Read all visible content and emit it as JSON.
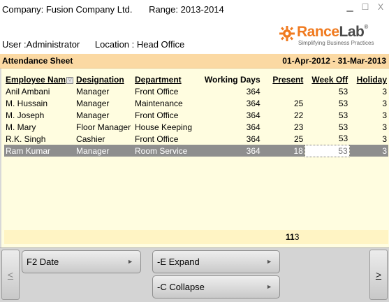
{
  "header": {
    "company": "Company: Fusion Company Ltd.",
    "range": "Range: 2013-2014",
    "user": "User :Administrator",
    "location": "Location : Head Office",
    "window_controls": {
      "minimize": "▁",
      "maximize": "☐",
      "close": "X"
    }
  },
  "logo": {
    "brand_part1": "Rance",
    "brand_part2": "Lab",
    "registered": "®",
    "tagline": "Simplifying Business Practices",
    "accent_color": "#f07a1f"
  },
  "title_bar": {
    "title": "Attendance Sheet",
    "period": "01-Apr-2012 - 31-Mar-2013",
    "background": "#fbd9a3"
  },
  "table": {
    "columns": [
      "Employee Nam",
      "Designation",
      "Department",
      "Working Days",
      "Present",
      "Week Off",
      "Holiday"
    ],
    "filter_icon": "▽",
    "rows": [
      {
        "name": "Anil Ambani",
        "designation": "Manager",
        "department": "Front Office",
        "working_days": "364",
        "present": "",
        "week_off": "53",
        "holiday": "3"
      },
      {
        "name": "M. Hussain",
        "designation": "Manager",
        "department": "Maintenance",
        "working_days": "364",
        "present": "25",
        "week_off": "53",
        "holiday": "3"
      },
      {
        "name": "M. Joseph",
        "designation": "Manager",
        "department": "Front Office",
        "working_days": "364",
        "present": "22",
        "week_off": "53",
        "holiday": "3"
      },
      {
        "name": "M. Mary",
        "designation": "Floor Manager",
        "department": "House Keeping",
        "working_days": "364",
        "present": "23",
        "week_off": "53",
        "holiday": "3"
      },
      {
        "name": "R.K. Singh",
        "designation": "Cashier",
        "department": "Front Office",
        "working_days": "364",
        "present": "25",
        "week_off": "53",
        "holiday": "3"
      },
      {
        "name": "Ram Kumar",
        "designation": "Manager",
        "department": "Room Service",
        "working_days": "364",
        "present": "18",
        "week_off": "53",
        "holiday": "3"
      }
    ],
    "selected_row_index": 5
  },
  "totals": {
    "present_total_bold": "11",
    "present_total_tail": "3"
  },
  "footer": {
    "nav_left": "<",
    "nav_right": ">",
    "buttons": {
      "date": "F2 Date",
      "expand": "-E Expand",
      "collapse": "-C Collapse"
    },
    "arrow_glyph": "►"
  }
}
